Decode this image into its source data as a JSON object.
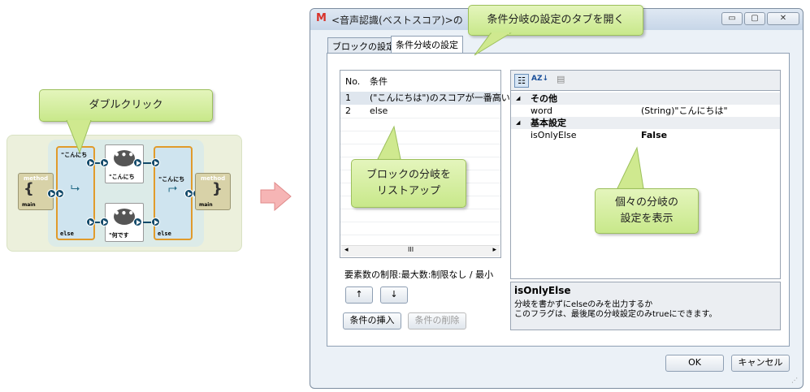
{
  "diagram": {
    "method_left": {
      "title": "method",
      "brace": "{",
      "name": "main"
    },
    "method_right": {
      "title": "method",
      "brace": "}",
      "name": "main"
    },
    "branch_left": {
      "top": "\"こんにち",
      "bottom": "else"
    },
    "branch_right": {
      "top": "\"こんにち",
      "bottom": "else"
    },
    "talk_top": {
      "text": "\"こんにち",
      "bubble": "•••"
    },
    "talk_bottom": {
      "text": "\"何です",
      "bubble": "•••"
    }
  },
  "callouts": {
    "double_click": "ダブルクリック",
    "open_tab": "条件分岐の設定のタブを開く",
    "list_up_1": "ブロックの分岐を",
    "list_up_2": "リストアップ",
    "show_settings_1": "個々の分岐の",
    "show_settings_2": "設定を表示"
  },
  "dialog": {
    "title": "<音声認識(ベストスコア)>の",
    "app_icon": "M",
    "buttons": {
      "minimize": "▭",
      "maximize": "▢",
      "close": "✕"
    },
    "tabs": [
      {
        "label": "ブロックの設定",
        "active": false
      },
      {
        "label": "条件分岐の設定",
        "active": true
      }
    ],
    "list": {
      "headers": {
        "no": "No.",
        "cond": "条件"
      },
      "rows": [
        {
          "no": "1",
          "cond": "(\"こんにちは\")のスコアが一番高い"
        },
        {
          "no": "2",
          "cond": "else"
        }
      ],
      "scroll_left": "◂",
      "scroll_right": "▸",
      "scroll_thumb": "III"
    },
    "limit_text": "要素数の制限:最大数:制限なし / 最小",
    "up_button": "↑",
    "down_button": "↓",
    "insert_button": "条件の挿入",
    "delete_button": "条件の削除",
    "props": {
      "toolbar_categorized": "☷",
      "toolbar_sort": "AZ↓",
      "toolbar_pages": "▤",
      "groups": [
        {
          "expander": "◢",
          "name": "その他",
          "items": [
            {
              "key": "word",
              "value": "(String)\"こんにちは\""
            }
          ]
        },
        {
          "expander": "◢",
          "name": "基本設定",
          "items": [
            {
              "key": "isOnlyElse",
              "value": "False"
            }
          ]
        }
      ]
    },
    "description": {
      "title": "isOnlyElse",
      "line1": "分岐を書かずにelseのみを出力するか",
      "line2": "このフラグは、最後尾の分岐設定のみtrueにできます。"
    },
    "ok": "OK",
    "cancel": "キャンセル"
  },
  "colors": {
    "callout": "#d2ec9c",
    "accent_port": "#134a6a",
    "block_border": "#e19b2b"
  }
}
